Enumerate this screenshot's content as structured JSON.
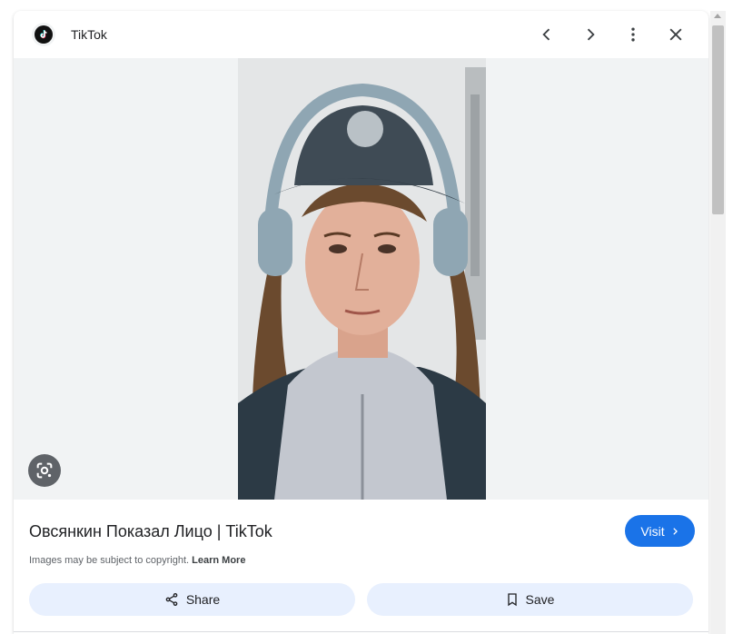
{
  "header": {
    "source_name": "TikTok",
    "icons": [
      "tiktok-logo-icon",
      "chevron-left-icon",
      "chevron-right-icon",
      "more-vert-icon",
      "close-icon"
    ]
  },
  "media": {
    "lens_icon": "lens-icon"
  },
  "info": {
    "title": "Овсянкин Показал Лицо | TikTok",
    "visit_label": "Visit",
    "copyright_text": "Images may be subject to copyright.",
    "learn_more_label": "Learn More"
  },
  "actions": {
    "share_label": "Share",
    "save_label": "Save"
  },
  "colors": {
    "accent": "#1a73e8",
    "action_bg": "#e8f0fe",
    "media_bg": "#f1f3f4"
  }
}
